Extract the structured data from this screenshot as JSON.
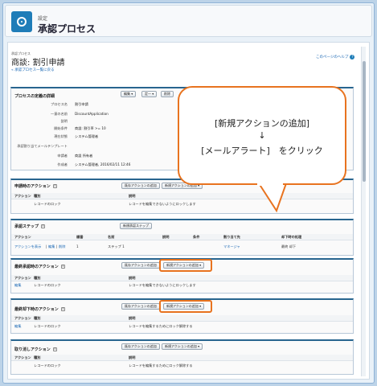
{
  "header": {
    "subtitle": "設定",
    "title": "承認プロセス",
    "app_icon": "approval-process-icon"
  },
  "record": {
    "type_label": "承認プロセス",
    "title": "商談: 割引申請",
    "back_link": "« 承認プロセス一覧に戻る",
    "help_link": "このページのヘルプ"
  },
  "definition": {
    "heading": "プロセスの定義の詳細",
    "buttons": [
      "編集",
      "定一",
      "削除"
    ],
    "fields": [
      {
        "label": "プロセス名",
        "value": "割引申請"
      },
      {
        "label": "一意の名前",
        "value": "DiscountApplication"
      },
      {
        "label": "説明",
        "value": ""
      },
      {
        "label": "開始条件",
        "value": "商談: 割引率 >= 10"
      },
      {
        "label": "現在状態",
        "value": "システム管理者"
      },
      {
        "label": "承認割り当てメールテンプレート",
        "value": ""
      },
      {
        "label": "申請者",
        "value": "商談 所有者"
      },
      {
        "label": "作成者",
        "value": "システム管理者, 2016/02/11 12:46"
      }
    ]
  },
  "callout": {
    "line1": "[新規アクションの追加]",
    "arrow": "↓",
    "line2": "[メールアラート]　をクリック"
  },
  "sections": {
    "initial": {
      "heading": "申請時のアクション",
      "btn_existing": "既存アクションの追加",
      "btn_new": "新規アクションの追加",
      "cols": [
        "アクション",
        "種別",
        "説明"
      ],
      "rows": [
        {
          "action": "",
          "type": "レコードのロック",
          "desc": "レコードを編集できないようにロックします"
        }
      ]
    },
    "steps": {
      "heading": "承認ステップ",
      "btn_new": "新規承認ステップ",
      "cols": [
        "アクション",
        "順番",
        "名前",
        "説明",
        "条件",
        "割り当て先",
        "却下時の処理"
      ],
      "rows": [
        {
          "action_show": "アクションを表示",
          "action_edit": "編集",
          "action_del": "削除",
          "order": "1",
          "name": "ステップ 1",
          "desc": "",
          "criteria": "",
          "assignee": "マネージャ",
          "reject": "最終 却下"
        }
      ]
    },
    "final_approval": {
      "heading": "最終承認時のアクション",
      "btn_existing": "既存アクションの追加",
      "btn_new": "新規アクションの追加",
      "cols": [
        "アクション",
        "種別",
        "説明"
      ],
      "rows": [
        {
          "action": "編集",
          "type": "レコードのロック",
          "desc": "レコードを編集できないようにロックします"
        }
      ]
    },
    "final_rejection": {
      "heading": "最終却下時のアクション",
      "btn_existing": "既存アクションの追加",
      "btn_new": "新規アクションの追加",
      "cols": [
        "アクション",
        "種別",
        "説明"
      ],
      "rows": [
        {
          "action": "編集",
          "type": "レコードのロック",
          "desc": "レコードを編集するためにロック解除する"
        }
      ]
    },
    "recall": {
      "heading": "取り消しアクション",
      "btn_existing": "既存アクションの追加",
      "btn_new": "新規アクションの追加",
      "cols": [
        "アクション",
        "種別",
        "説明"
      ],
      "rows": [
        {
          "action": "",
          "type": "レコードのロック",
          "desc": "レコードを編集するためにロック解除する"
        }
      ]
    }
  },
  "colors": {
    "accent": "#1f7db8",
    "highlight": "#e8731f",
    "section_border": "#28658f"
  }
}
